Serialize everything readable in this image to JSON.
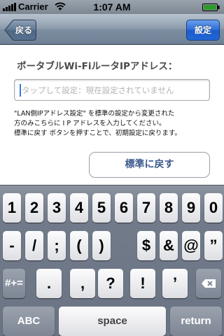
{
  "status_bar": {
    "carrier": "Carrier",
    "time": "1:07 AM"
  },
  "nav": {
    "back_label": "戻る",
    "set_label": "設定"
  },
  "content": {
    "heading": "ポータブルWi-FiルータIPアドレス：",
    "ip_field": {
      "placeholder": "タップして設定：現在設定されていません",
      "value": ""
    },
    "description_lines": [
      "\"LAN側IPアドレス設定\" を標準の設定から変更された",
      "方のみこちらに I P アドレスを入力してください。",
      "標準に戻す ボタンを押すことで、初期設定に戻ります。"
    ],
    "reset_label": "標準に戻す"
  },
  "keyboard": {
    "row1": [
      "1",
      "2",
      "3",
      "4",
      "5",
      "6",
      "7",
      "8",
      "9",
      "0"
    ],
    "row2": [
      "-",
      "/",
      ";",
      "(",
      ")",
      "$",
      "&",
      "@",
      "”"
    ],
    "row3": [
      ".",
      ",",
      "?",
      "!",
      "’"
    ],
    "mode_label": "#+=",
    "abc_label": "ABC",
    "space_label": "space",
    "return_label": "return"
  }
}
